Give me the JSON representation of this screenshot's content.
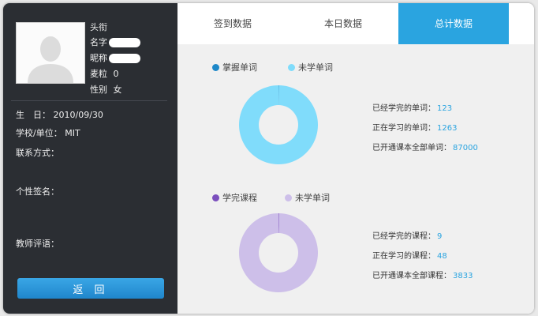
{
  "colors": {
    "sidebar_bg": "#2b2e33",
    "accent": "#2aa4e0",
    "mastered": "#1e88c8",
    "unlearned_words": "#80dcfb",
    "completed_courses": "#7b4fbd",
    "unlearned_courses": "#cdbfe9"
  },
  "profile": {
    "title_label": "头衔",
    "name_label": "名字",
    "nickname_label": "昵称",
    "points_label": "麦粒",
    "points_value": "0",
    "gender_label": "性别",
    "gender_value": "女",
    "birthday_label": "生　日：",
    "birthday_value": "2010/09/30",
    "school_label": "学校/单位：",
    "school_value": "MIT",
    "contact_label": "联系方式：",
    "signature_label": "个性签名：",
    "teacher_comment_label": "教师评语：",
    "back_button": "返 回"
  },
  "tabs": [
    {
      "label": "签到数据",
      "active": false
    },
    {
      "label": "本日数据",
      "active": false
    },
    {
      "label": "总计数据",
      "active": true
    }
  ],
  "words": {
    "legend": [
      "掌握单词",
      "未学单词"
    ],
    "completed_label": "已经学完的单词：",
    "completed": 123,
    "learning_label": "正在学习的单词：",
    "learning": 1263,
    "total_label": "已开通课本全部单词：",
    "total": 87000
  },
  "courses": {
    "legend": [
      "学完课程",
      "未学单词"
    ],
    "completed_label": "已经学完的课程：",
    "completed": 9,
    "learning_label": "正在学习的课程：",
    "learning": 48,
    "total_label": "已开通课本全部课程：",
    "total": 3833
  },
  "chart_data": [
    {
      "type": "pie",
      "categories": [
        "掌握单词",
        "未学单词"
      ],
      "values": [
        123,
        86877
      ]
    },
    {
      "type": "pie",
      "categories": [
        "学完课程",
        "未学单词"
      ],
      "values": [
        9,
        3824
      ]
    }
  ]
}
